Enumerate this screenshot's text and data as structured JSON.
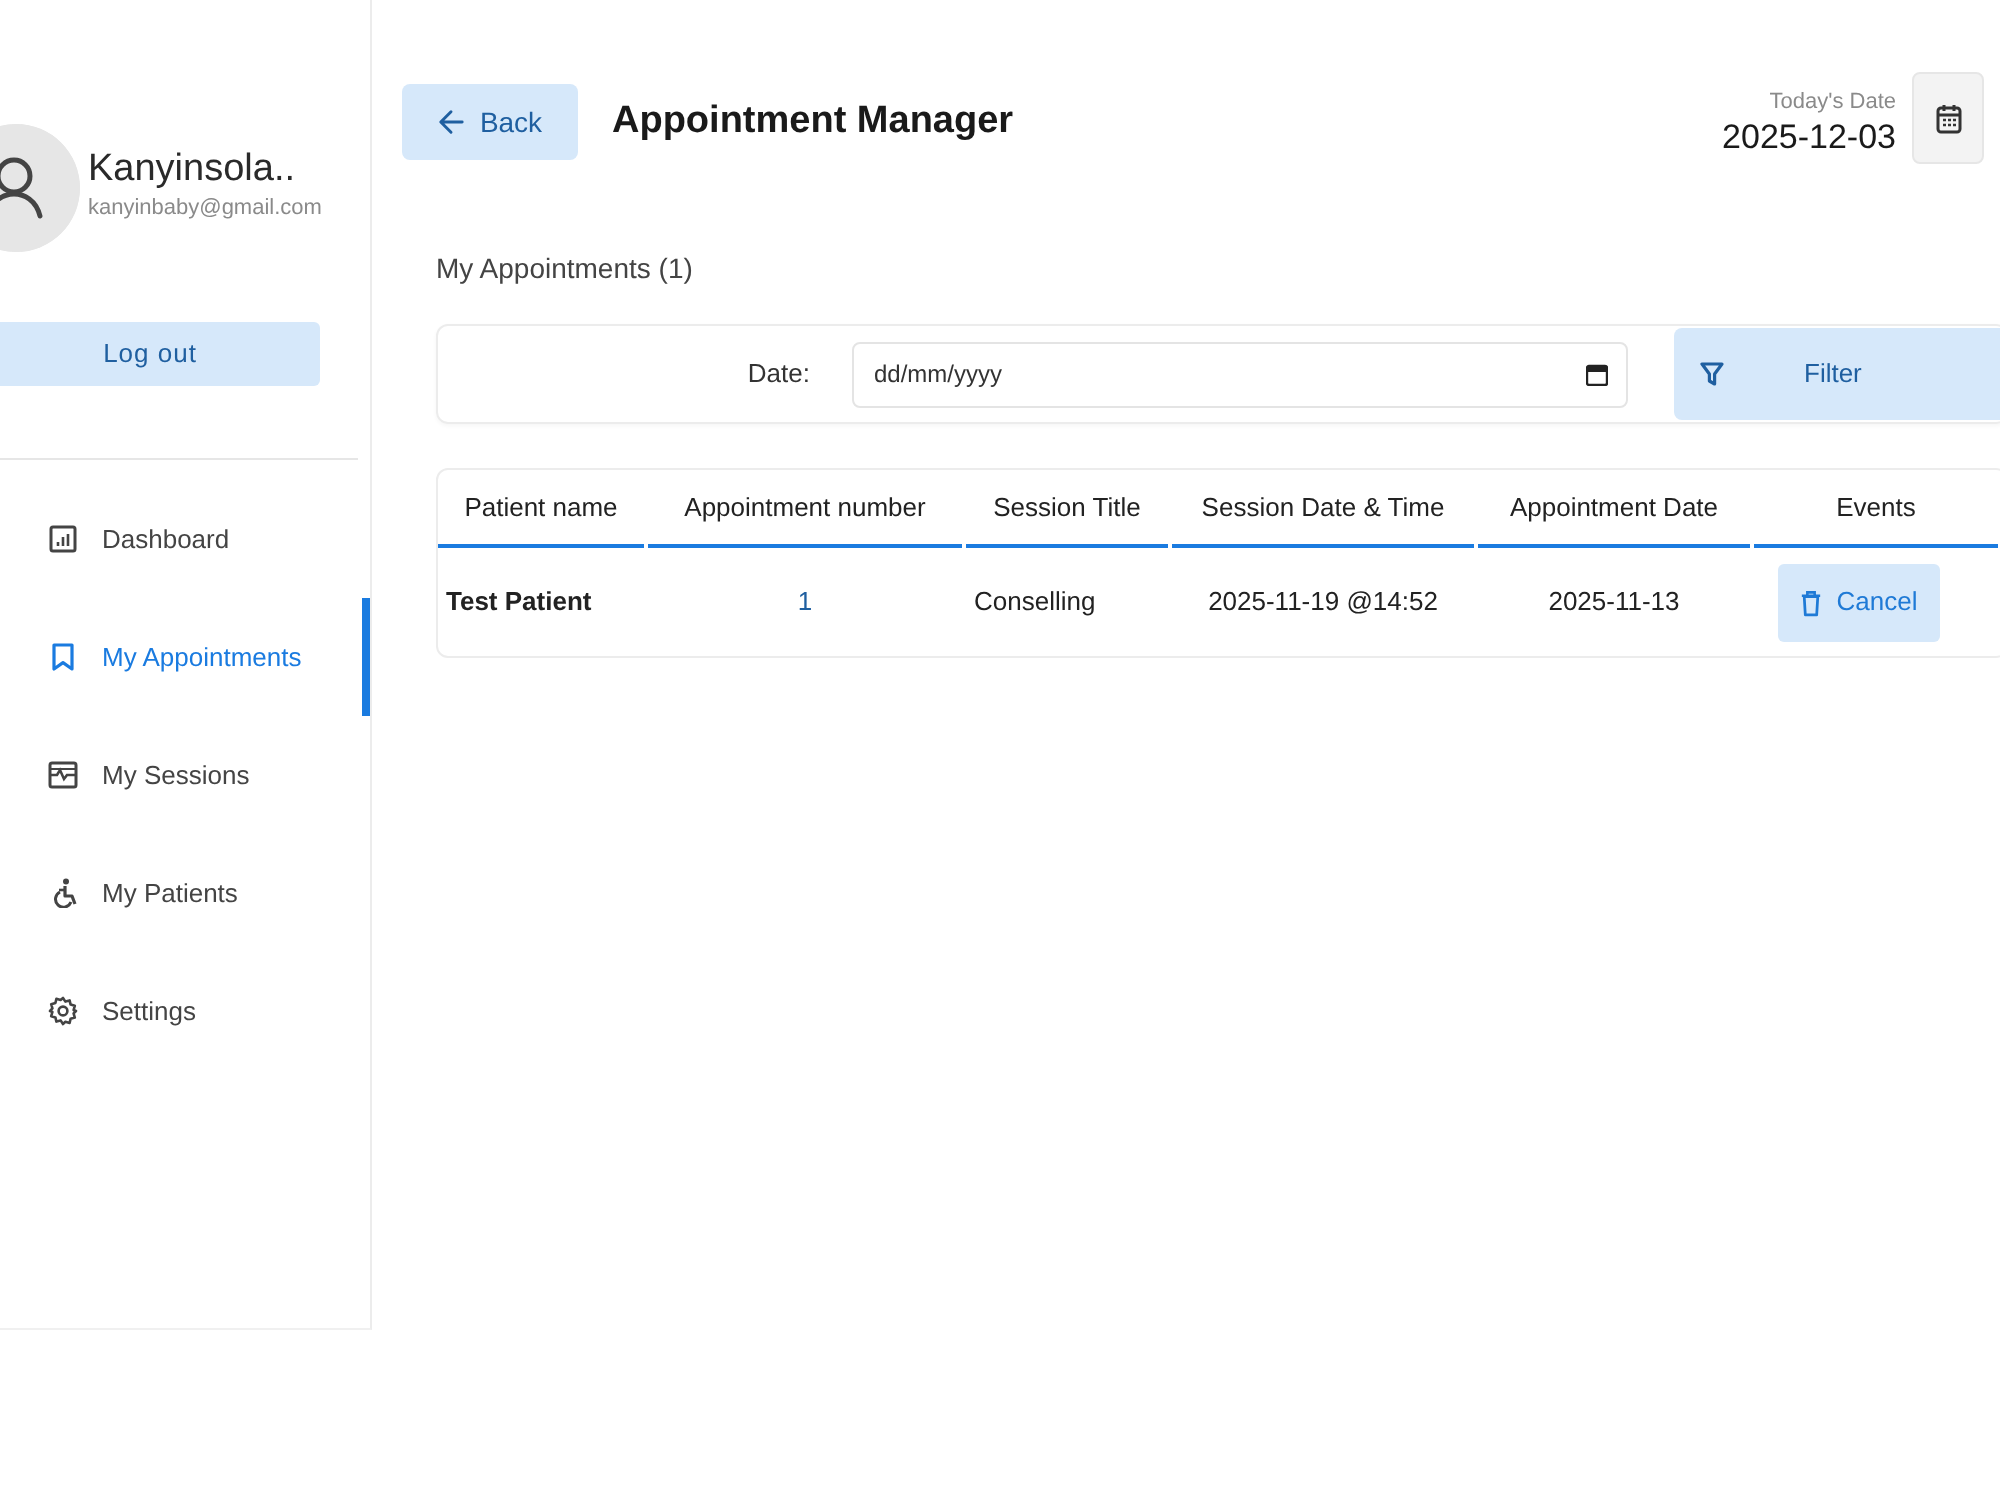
{
  "sidebar": {
    "user": {
      "name": "Kanyinsola..",
      "email": "kanyinbaby@gmail.com"
    },
    "logout_button": "Log out",
    "items": [
      {
        "label": "Dashboard",
        "selected": false
      },
      {
        "label": "My Appointments",
        "selected": true
      },
      {
        "label": "My Sessions",
        "selected": false
      },
      {
        "label": "My Patients",
        "selected": false
      },
      {
        "label": "Settings",
        "selected": false
      }
    ]
  },
  "header": {
    "back_button": "Back",
    "title": "Appointment Manager",
    "today_label": "Today's Date",
    "today_value": "2025-12-03"
  },
  "appointments": {
    "heading": "My Appointments (1)",
    "filter": {
      "label": "Date:",
      "placeholder": "dd/mm/yyyy",
      "button": "Filter"
    },
    "table": {
      "columns": [
        "Patient name",
        "Appointment number",
        "Session Title",
        "Session Date & Time",
        "Appointment Date",
        "Events"
      ],
      "rows": [
        {
          "patient_name": "Test Patient",
          "appointment_number": "1",
          "session_title": "Conselling",
          "session_date_time": "2025-11-19 @14:52",
          "appointment_date": "2025-11-13",
          "action": "Cancel"
        }
      ]
    }
  }
}
